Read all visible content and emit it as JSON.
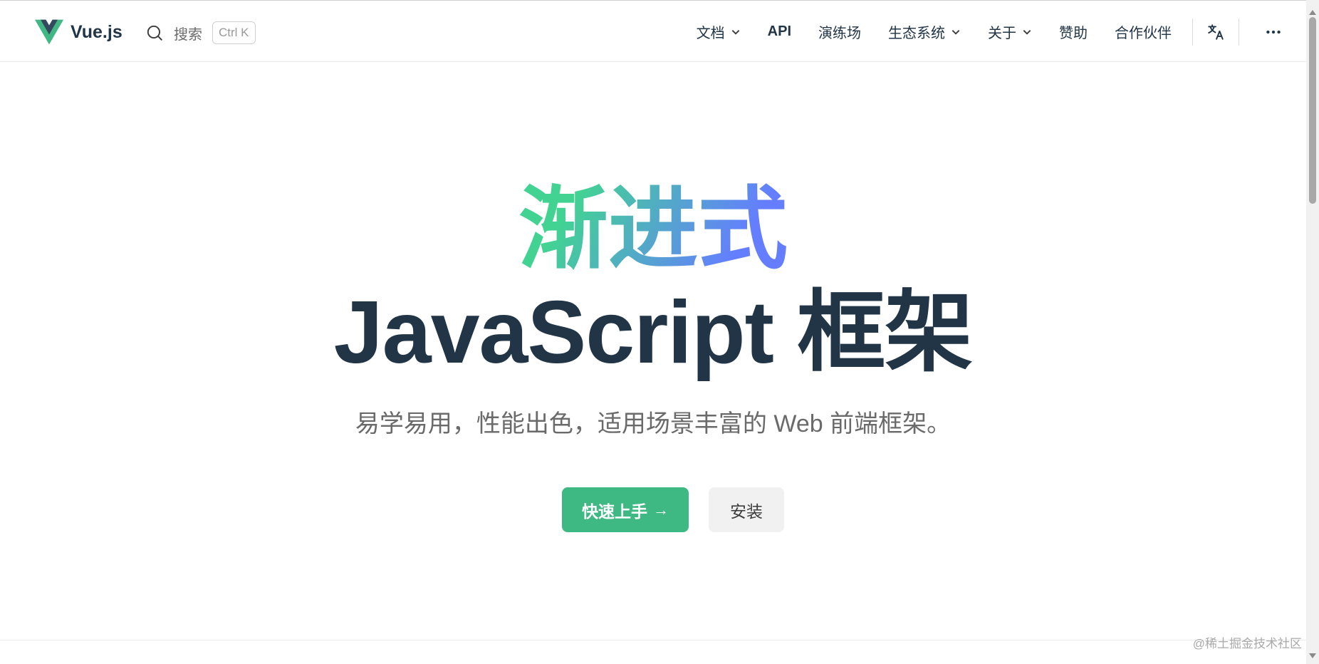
{
  "nav": {
    "logo_text": "Vue.js",
    "search_label": "搜索",
    "search_shortcut": "Ctrl K",
    "items": [
      {
        "label": "文档",
        "dropdown": true
      },
      {
        "label": "API",
        "dropdown": false
      },
      {
        "label": "演练场",
        "dropdown": false
      },
      {
        "label": "生态系统",
        "dropdown": true
      },
      {
        "label": "关于",
        "dropdown": true
      },
      {
        "label": "赞助",
        "dropdown": false
      },
      {
        "label": "合作伙伴",
        "dropdown": false
      }
    ]
  },
  "hero": {
    "name": "渐进式",
    "title": "JavaScript 框架",
    "tagline": "易学易用，性能出色，适用场景丰富的 Web 前端框架。",
    "primary_label": "快速上手",
    "primary_arrow": "→",
    "secondary_label": "安装"
  },
  "watermark": "@稀土掘金技术社区",
  "colors": {
    "brand": "#3fb984",
    "gradient_start": "#42d392",
    "gradient_end": "#647eff",
    "text": "#213547"
  },
  "icons": {
    "logo": "vue-logo-icon",
    "search": "search-icon",
    "dropdown": "chevron-down-icon",
    "language": "translate-icon",
    "more": "more-horizontal-icon"
  }
}
